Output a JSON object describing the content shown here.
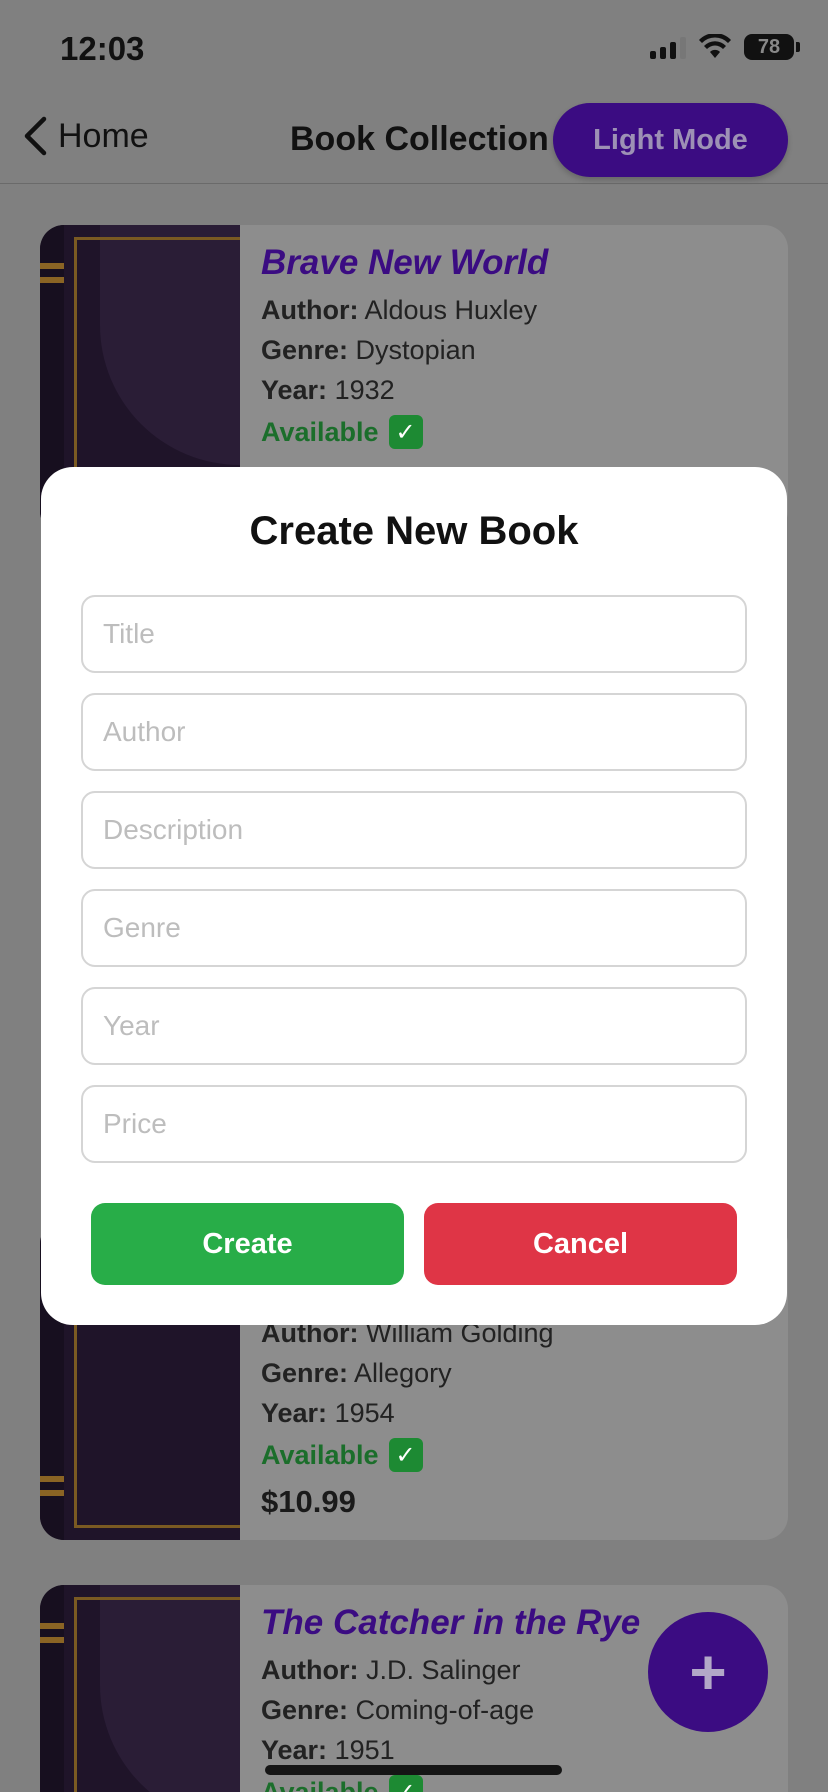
{
  "status_bar": {
    "time": "12:03",
    "battery": "78"
  },
  "nav": {
    "back_label": "Home",
    "title": "Book Collection",
    "mode_button": "Light Mode"
  },
  "books": [
    {
      "title": "Brave New World",
      "author_label": "Author:",
      "author": "Aldous Huxley",
      "genre_label": "Genre:",
      "genre": "Dystopian",
      "year_label": "Year:",
      "year": "1932",
      "status": "Available"
    },
    {
      "author_label": "Author:",
      "author": "William Golding",
      "genre_label": "Genre:",
      "genre": "Allegory",
      "year_label": "Year:",
      "year": "1954",
      "status": "Available",
      "price": "$10.99"
    },
    {
      "title": "The Catcher in the Rye",
      "author_label": "Author:",
      "author": "J.D. Salinger",
      "genre_label": "Genre:",
      "genre": "Coming-of-age",
      "year_label": "Year:",
      "year": "1951",
      "status": "Available"
    }
  ],
  "modal": {
    "title": "Create New Book",
    "placeholders": {
      "title": "Title",
      "author": "Author",
      "description": "Description",
      "genre": "Genre",
      "year": "Year",
      "price": "Price"
    },
    "create_label": "Create",
    "cancel_label": "Cancel"
  },
  "fab": {
    "label": "+"
  },
  "colors": {
    "accent": "#3b0c82",
    "create": "#28ad48",
    "cancel": "#df3546",
    "available": "#1b6e2b"
  },
  "icons": {
    "back": "chevron-left-icon",
    "check": "checkmark-icon",
    "add": "plus-icon"
  }
}
